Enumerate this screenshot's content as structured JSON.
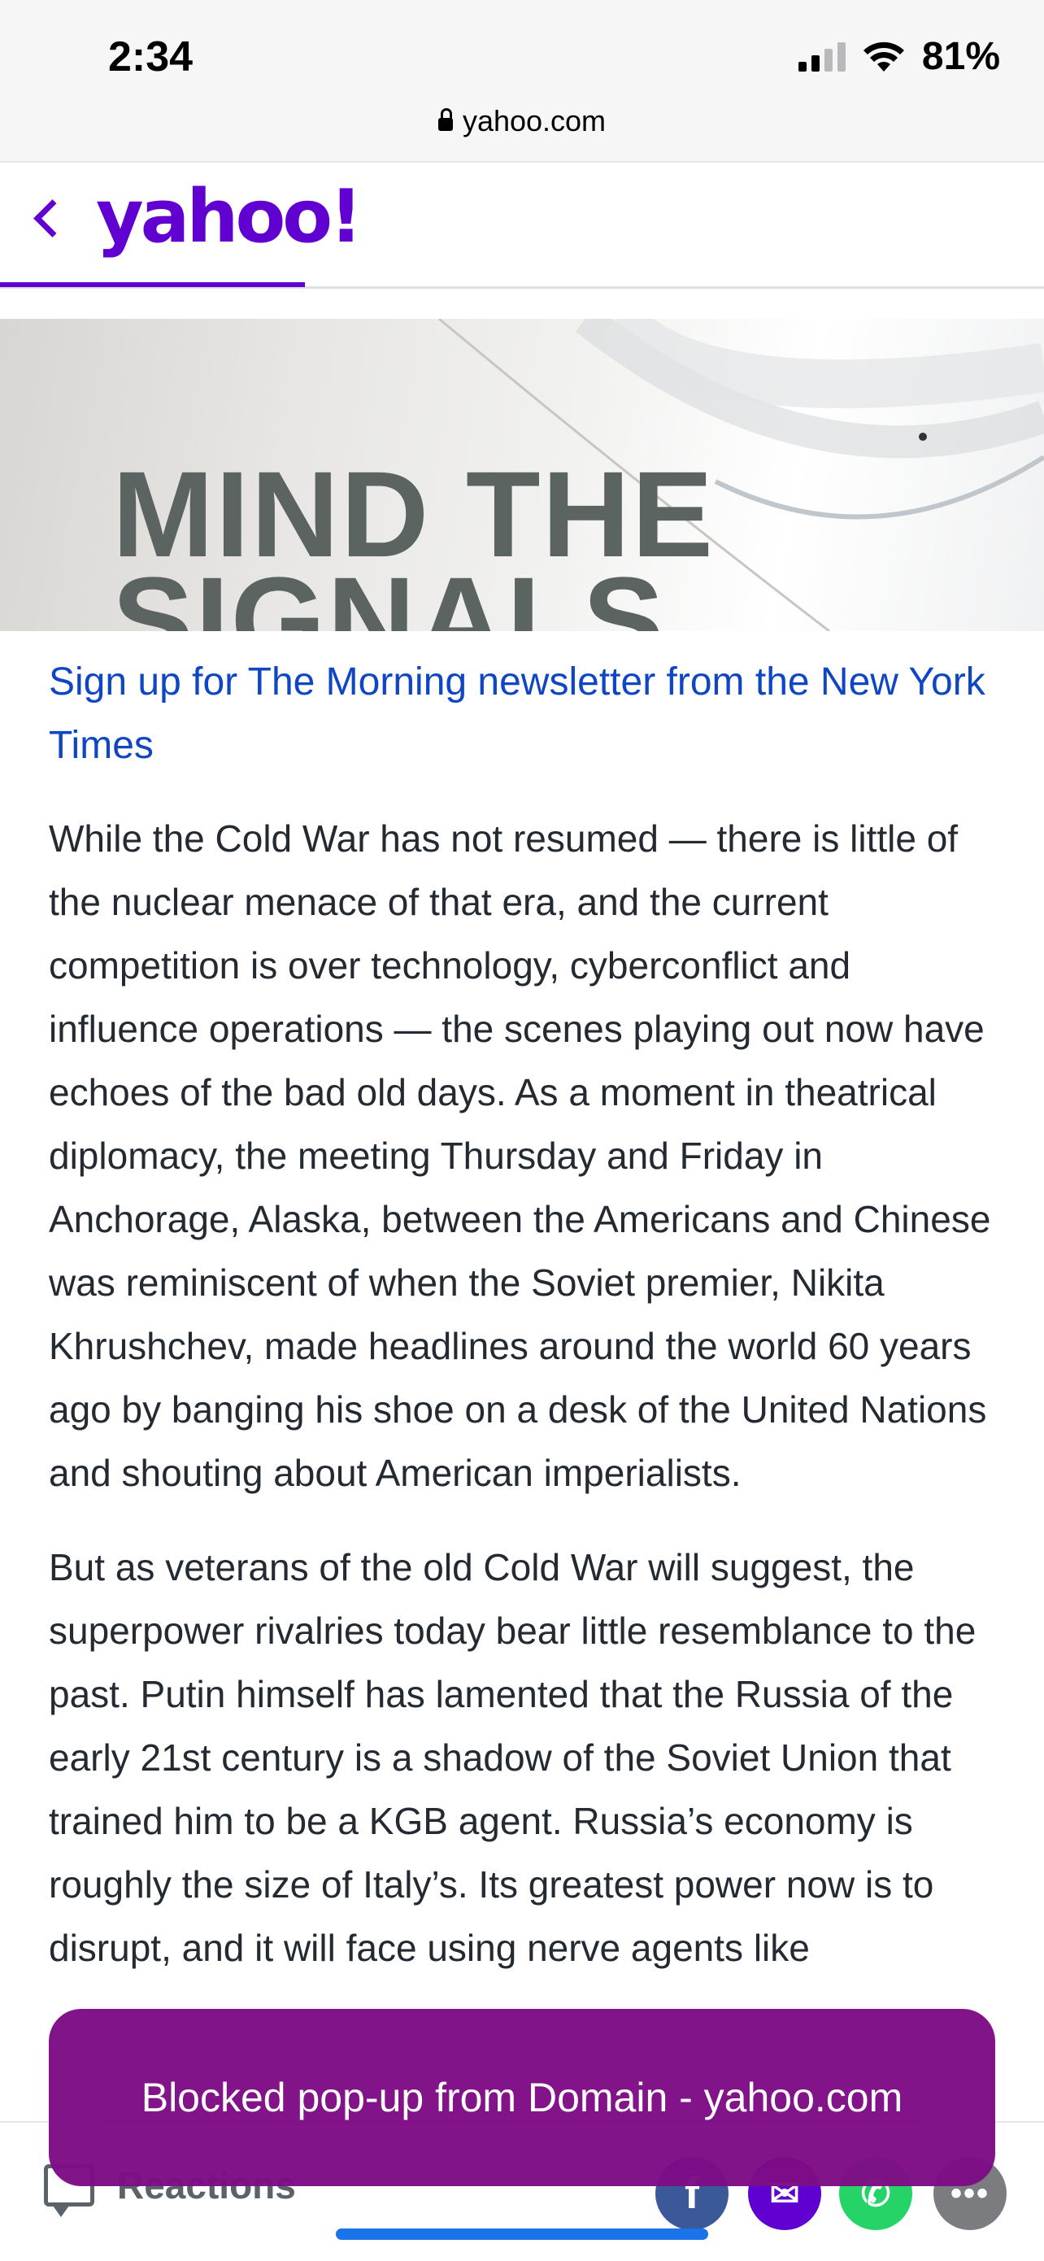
{
  "status_bar": {
    "time": "2:34",
    "battery": "81%",
    "url": "yahoo.com"
  },
  "nav": {
    "logo": "yahoo!"
  },
  "hero": {
    "title_line1": "MIND THE",
    "title_line2": "SIGNALS"
  },
  "article": {
    "signup_link": "Sign up for The Morning newsletter from the New York Times",
    "paragraphs": [
      "While the Cold War has not resumed — there is little of the nuclear menace of that era, and the current competition is over technology, cyberconflict and influence operations — the scenes playing out now have echoes of the bad old days. As a moment in theatrical diplomacy, the meeting Thursday and Friday in Anchorage, Alaska, between the Americans and Chinese was reminiscent of when the Soviet premier, Nikita Khrushchev, made headlines around the world 60 years ago by banging his shoe on a desk of the United Nations and shouting about American imperialists.",
      "But as veterans of the old Cold War will suggest, the superpower rivalries today bear little resemblance to the past. Putin himself has lamented that the Russia of the early 21st century is a shadow of the Soviet Union that trained him to be a KGB agent. Russia’s economy is roughly the size of Italy’s. Its greatest power now is to disrupt, and it will face using nerve agents like"
    ]
  },
  "footer": {
    "reactions_label": "Reactions",
    "facebook": "f",
    "mail": "✉",
    "whatsapp": "✆",
    "more": "•••"
  },
  "popup": {
    "message": "Blocked pop-up from Domain - yahoo.com"
  }
}
